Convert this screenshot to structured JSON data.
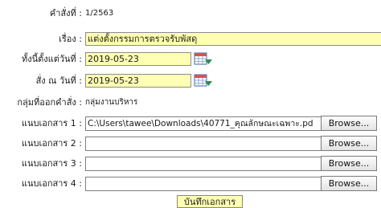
{
  "order": {
    "label": "คำสั่งที่ :",
    "value": "1/2563"
  },
  "subject": {
    "label": "เรื่อง :",
    "value": "แต่งตั้งกรรมการตรวจรับพัสดุ"
  },
  "effective_date": {
    "label": "ทั้งนี้ตั้งแต่วันที่ :",
    "value": "2019-05-23",
    "icon": "calendar-icon"
  },
  "order_date": {
    "label": "สั่ง ณ วันที่ :",
    "value": "2019-05-23",
    "icon": "calendar-icon"
  },
  "issuing_group": {
    "label": "กลุ่มที่ออกคำสั่ง :",
    "value": "กลุ่มงานบริหาร"
  },
  "attachments": [
    {
      "label": "แนบเอกสาร 1 :",
      "value": "C:\\Users\\tawee\\Downloads\\40771_คุณลักษณะเฉพาะ.pd",
      "browse_label": "Browse..."
    },
    {
      "label": "แนบเอกสาร 2 :",
      "value": "",
      "browse_label": "Browse..."
    },
    {
      "label": "แนบเอกสาร 3 :",
      "value": "",
      "browse_label": "Browse..."
    },
    {
      "label": "แนบเอกสาร 4 :",
      "value": "",
      "browse_label": "Browse..."
    }
  ],
  "save_button": {
    "label": "บันทึกเอกสาร"
  },
  "colors": {
    "input_bg": "#ffffb3",
    "calendar_accent": "#2e8b57"
  }
}
